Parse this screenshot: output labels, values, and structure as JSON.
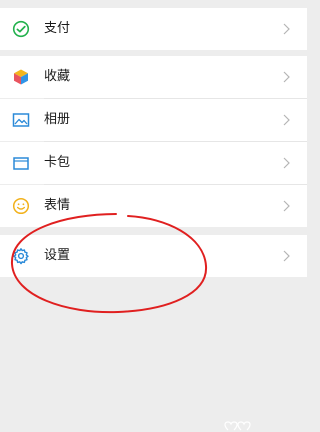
{
  "colors": {
    "background": "#ededed",
    "row_bg": "#ffffff",
    "text": "#1a1a1a",
    "chevron": "#b5b5b5",
    "pay_icon": "#23b14d",
    "photo_icon": "#2b8ad8",
    "card_icon": "#2b8ad8",
    "emoji_icon": "#f2b21d",
    "settings_icon": "#2b8ad8",
    "annotation": "#e02020"
  },
  "menu": {
    "pay": {
      "label": "支付",
      "icon": "wechat-pay-icon"
    },
    "favorites": {
      "label": "收藏",
      "icon": "favorites-cube-icon"
    },
    "album": {
      "label": "相册",
      "icon": "album-icon"
    },
    "cards": {
      "label": "卡包",
      "icon": "card-wallet-icon"
    },
    "stickers": {
      "label": "表情",
      "icon": "smile-icon"
    },
    "settings": {
      "label": "设置",
      "icon": "gear-icon"
    }
  }
}
